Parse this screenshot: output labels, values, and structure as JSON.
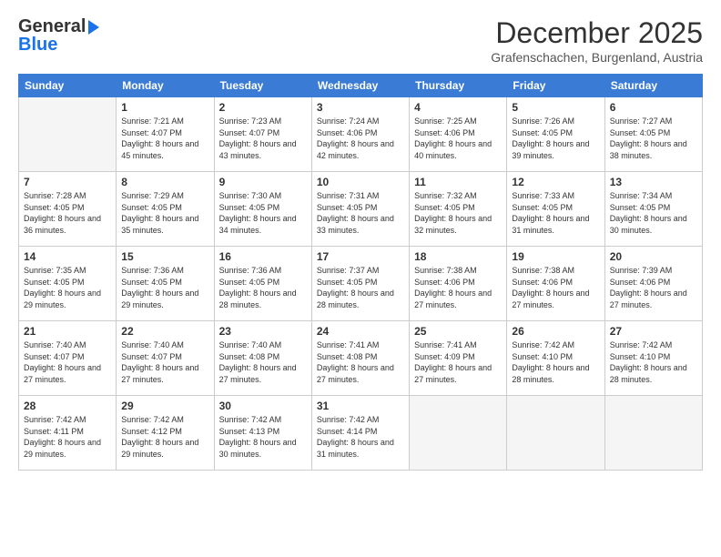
{
  "header": {
    "logo_line1": "General",
    "logo_line2": "Blue",
    "month_title": "December 2025",
    "location": "Grafenschachen, Burgenland, Austria"
  },
  "weekdays": [
    "Sunday",
    "Monday",
    "Tuesday",
    "Wednesday",
    "Thursday",
    "Friday",
    "Saturday"
  ],
  "weeks": [
    [
      {
        "day": "",
        "empty": true
      },
      {
        "day": "1",
        "sunrise": "7:21 AM",
        "sunset": "4:07 PM",
        "daylight": "8 hours and 45 minutes."
      },
      {
        "day": "2",
        "sunrise": "7:23 AM",
        "sunset": "4:07 PM",
        "daylight": "8 hours and 43 minutes."
      },
      {
        "day": "3",
        "sunrise": "7:24 AM",
        "sunset": "4:06 PM",
        "daylight": "8 hours and 42 minutes."
      },
      {
        "day": "4",
        "sunrise": "7:25 AM",
        "sunset": "4:06 PM",
        "daylight": "8 hours and 40 minutes."
      },
      {
        "day": "5",
        "sunrise": "7:26 AM",
        "sunset": "4:05 PM",
        "daylight": "8 hours and 39 minutes."
      },
      {
        "day": "6",
        "sunrise": "7:27 AM",
        "sunset": "4:05 PM",
        "daylight": "8 hours and 38 minutes."
      }
    ],
    [
      {
        "day": "7",
        "sunrise": "7:28 AM",
        "sunset": "4:05 PM",
        "daylight": "8 hours and 36 minutes."
      },
      {
        "day": "8",
        "sunrise": "7:29 AM",
        "sunset": "4:05 PM",
        "daylight": "8 hours and 35 minutes."
      },
      {
        "day": "9",
        "sunrise": "7:30 AM",
        "sunset": "4:05 PM",
        "daylight": "8 hours and 34 minutes."
      },
      {
        "day": "10",
        "sunrise": "7:31 AM",
        "sunset": "4:05 PM",
        "daylight": "8 hours and 33 minutes."
      },
      {
        "day": "11",
        "sunrise": "7:32 AM",
        "sunset": "4:05 PM",
        "daylight": "8 hours and 32 minutes."
      },
      {
        "day": "12",
        "sunrise": "7:33 AM",
        "sunset": "4:05 PM",
        "daylight": "8 hours and 31 minutes."
      },
      {
        "day": "13",
        "sunrise": "7:34 AM",
        "sunset": "4:05 PM",
        "daylight": "8 hours and 30 minutes."
      }
    ],
    [
      {
        "day": "14",
        "sunrise": "7:35 AM",
        "sunset": "4:05 PM",
        "daylight": "8 hours and 29 minutes."
      },
      {
        "day": "15",
        "sunrise": "7:36 AM",
        "sunset": "4:05 PM",
        "daylight": "8 hours and 29 minutes."
      },
      {
        "day": "16",
        "sunrise": "7:36 AM",
        "sunset": "4:05 PM",
        "daylight": "8 hours and 28 minutes."
      },
      {
        "day": "17",
        "sunrise": "7:37 AM",
        "sunset": "4:05 PM",
        "daylight": "8 hours and 28 minutes."
      },
      {
        "day": "18",
        "sunrise": "7:38 AM",
        "sunset": "4:06 PM",
        "daylight": "8 hours and 27 minutes."
      },
      {
        "day": "19",
        "sunrise": "7:38 AM",
        "sunset": "4:06 PM",
        "daylight": "8 hours and 27 minutes."
      },
      {
        "day": "20",
        "sunrise": "7:39 AM",
        "sunset": "4:06 PM",
        "daylight": "8 hours and 27 minutes."
      }
    ],
    [
      {
        "day": "21",
        "sunrise": "7:40 AM",
        "sunset": "4:07 PM",
        "daylight": "8 hours and 27 minutes."
      },
      {
        "day": "22",
        "sunrise": "7:40 AM",
        "sunset": "4:07 PM",
        "daylight": "8 hours and 27 minutes."
      },
      {
        "day": "23",
        "sunrise": "7:40 AM",
        "sunset": "4:08 PM",
        "daylight": "8 hours and 27 minutes."
      },
      {
        "day": "24",
        "sunrise": "7:41 AM",
        "sunset": "4:08 PM",
        "daylight": "8 hours and 27 minutes."
      },
      {
        "day": "25",
        "sunrise": "7:41 AM",
        "sunset": "4:09 PM",
        "daylight": "8 hours and 27 minutes."
      },
      {
        "day": "26",
        "sunrise": "7:42 AM",
        "sunset": "4:10 PM",
        "daylight": "8 hours and 28 minutes."
      },
      {
        "day": "27",
        "sunrise": "7:42 AM",
        "sunset": "4:10 PM",
        "daylight": "8 hours and 28 minutes."
      }
    ],
    [
      {
        "day": "28",
        "sunrise": "7:42 AM",
        "sunset": "4:11 PM",
        "daylight": "8 hours and 29 minutes."
      },
      {
        "day": "29",
        "sunrise": "7:42 AM",
        "sunset": "4:12 PM",
        "daylight": "8 hours and 29 minutes."
      },
      {
        "day": "30",
        "sunrise": "7:42 AM",
        "sunset": "4:13 PM",
        "daylight": "8 hours and 30 minutes."
      },
      {
        "day": "31",
        "sunrise": "7:42 AM",
        "sunset": "4:14 PM",
        "daylight": "8 hours and 31 minutes."
      },
      {
        "day": "",
        "empty": true
      },
      {
        "day": "",
        "empty": true
      },
      {
        "day": "",
        "empty": true
      }
    ]
  ],
  "labels": {
    "sunrise": "Sunrise:",
    "sunset": "Sunset:",
    "daylight": "Daylight:"
  }
}
